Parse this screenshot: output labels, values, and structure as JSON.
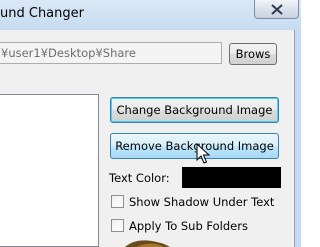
{
  "window": {
    "title": "und Changer"
  },
  "path_field": {
    "value": "¥user1¥Desktop¥Share"
  },
  "buttons": {
    "browse": "Brows",
    "change_background": "Change Background Image",
    "remove_background": "Remove Background Image"
  },
  "text_color": {
    "label": "Text Color:",
    "value": "#000000"
  },
  "options": {
    "show_shadow": {
      "label": "Show Shadow Under Text",
      "checked": false
    },
    "apply_sub_folders": {
      "label": "Apply To Sub Folders",
      "checked": false
    }
  },
  "icons": {
    "close": "close-icon",
    "cursor": "mouse-pointer-icon"
  }
}
